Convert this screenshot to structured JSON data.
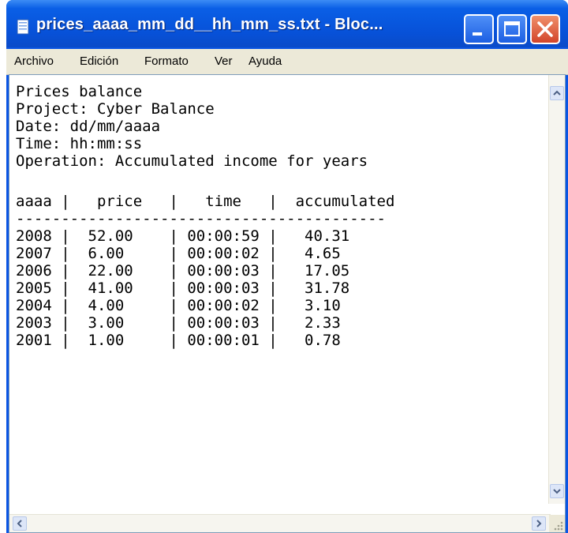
{
  "window": {
    "title": "prices_aaaa_mm_dd__hh_mm_ss.txt - Bloc..."
  },
  "menu": [
    "Archivo",
    "Edición",
    "Formato",
    "Ver",
    "Ayuda"
  ],
  "document": {
    "lines": [
      "Prices balance",
      "Project: Cyber Balance",
      "Date: dd/mm/aaaa",
      "Time: hh:mm:ss",
      "Operation: Accumulated income for years",
      "",
      "aaaa |   price   |   time   |  accumulated",
      "-----------------------------------------",
      "2008 |  52.00    | 00:00:59 |   40.31",
      "2007 |  6.00     | 00:00:02 |   4.65",
      "2006 |  22.00    | 00:00:03 |   17.05",
      "2005 |  41.00    | 00:00:03 |   31.78",
      "2004 |  4.00     | 00:00:02 |   3.10",
      "2003 |  3.00     | 00:00:03 |   2.33",
      "2001 |  1.00     | 00:00:01 |   0.78"
    ]
  }
}
